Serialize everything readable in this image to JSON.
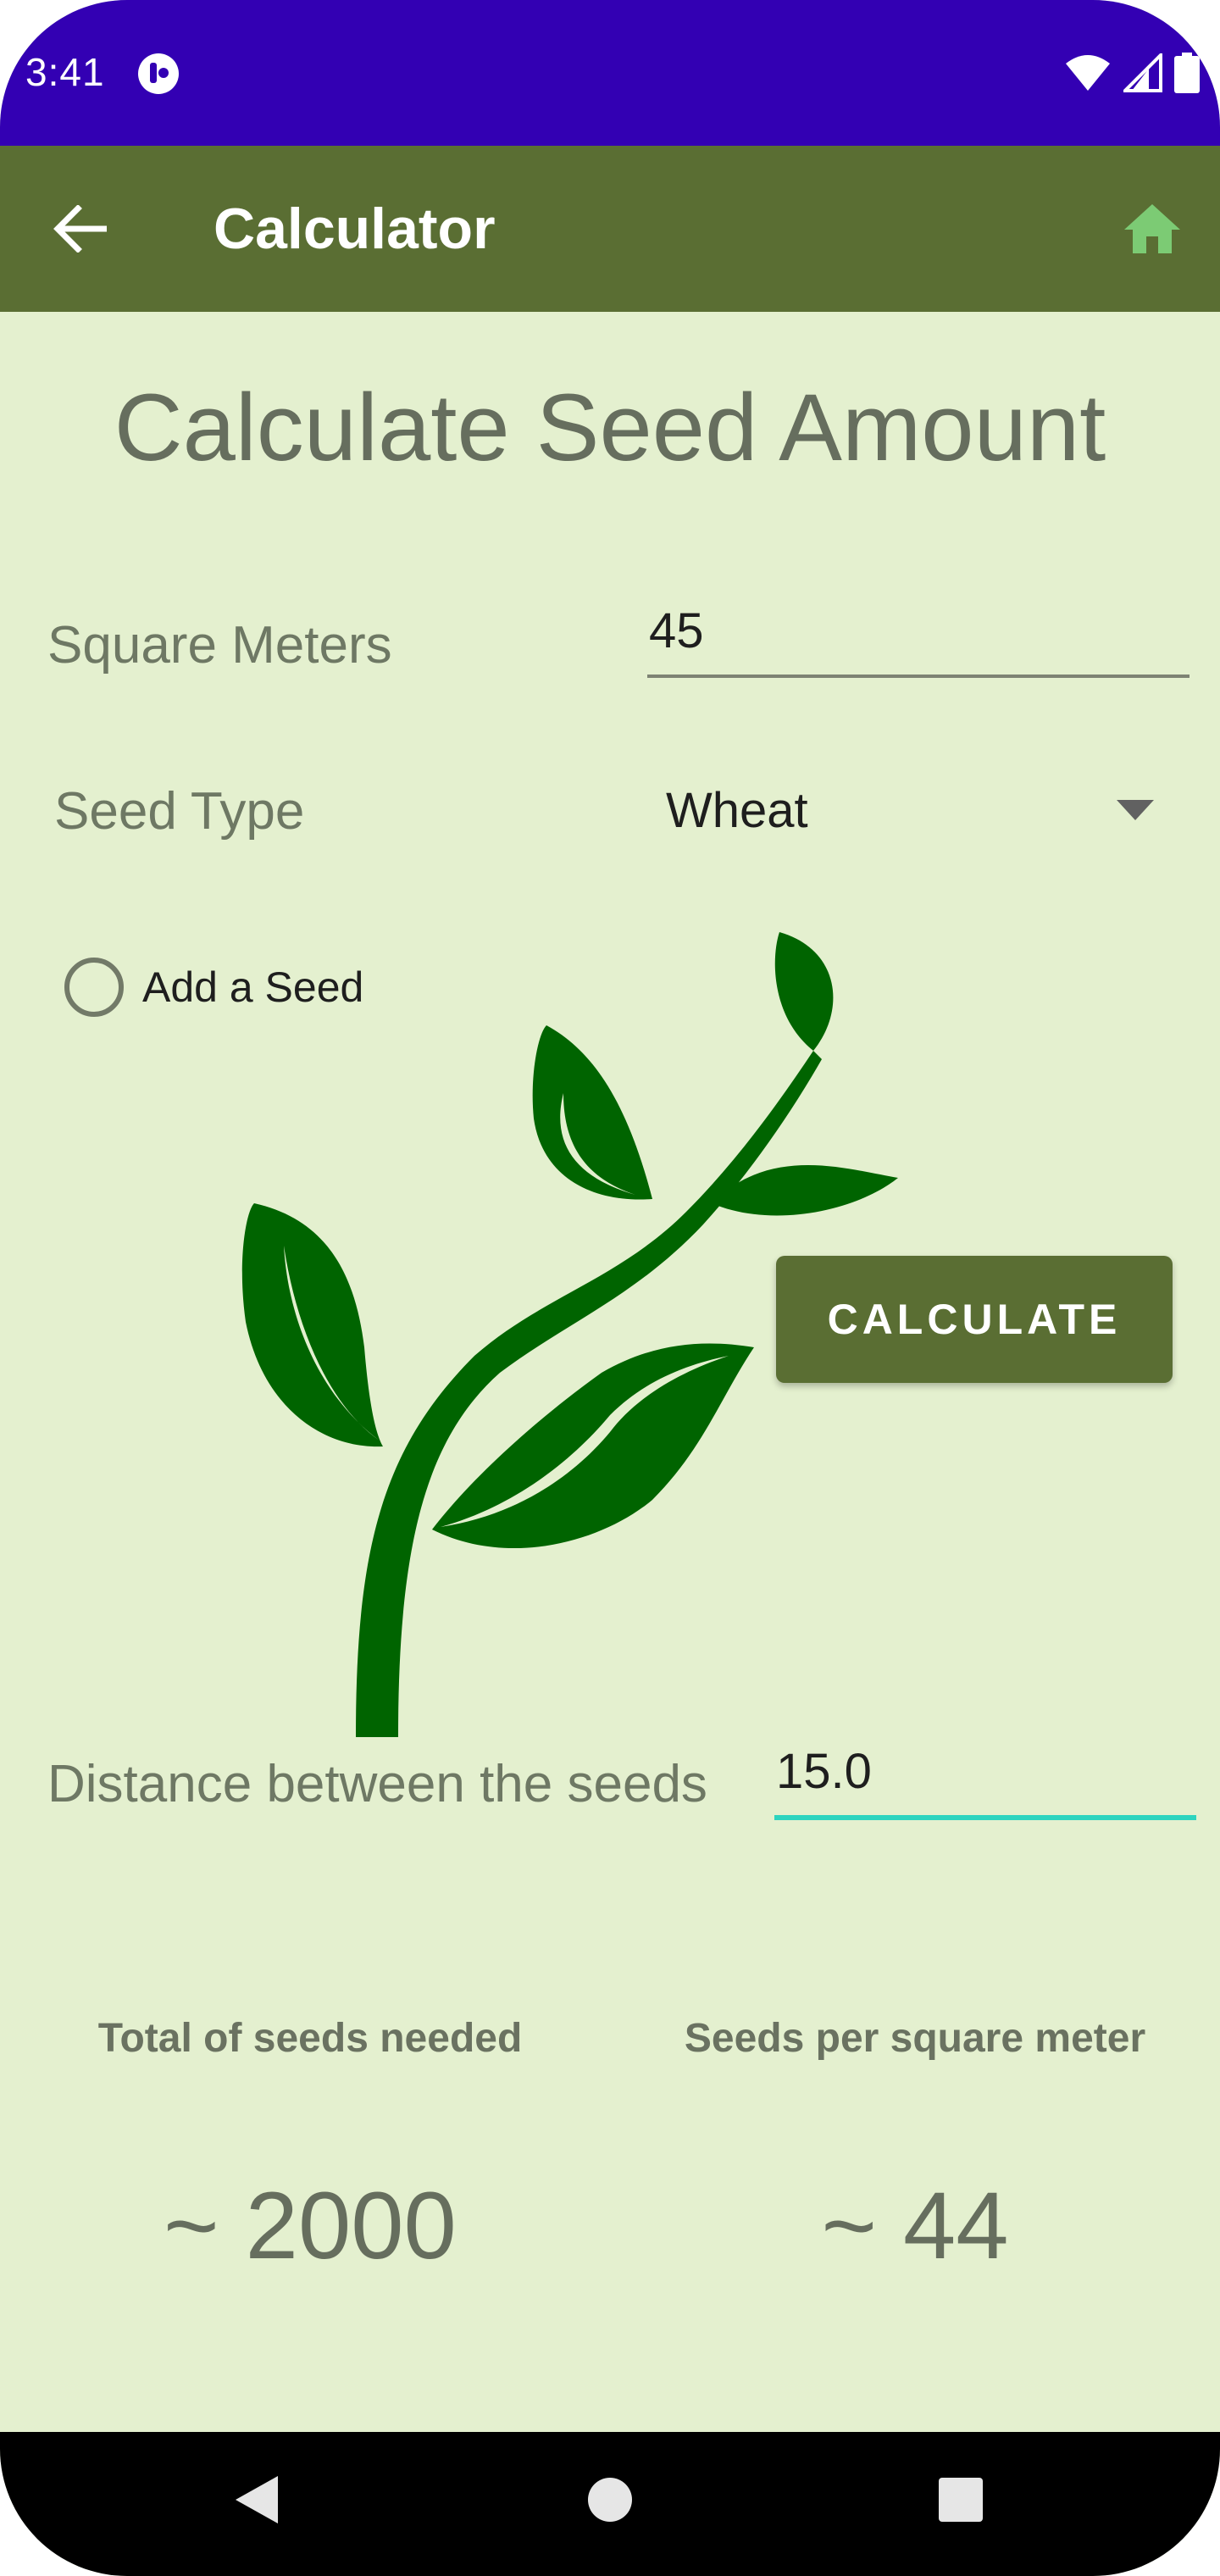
{
  "status_bar": {
    "time": "3:41",
    "app_icon": "notification-app-icon",
    "icons": [
      "wifi-icon",
      "signal-icon",
      "battery-icon"
    ]
  },
  "app_bar": {
    "title": "Calculator",
    "back_icon": "arrow-back-icon",
    "home_icon": "home-icon",
    "home_icon_color": "#7ccb74",
    "background_color": "#5a6e33"
  },
  "main": {
    "page_title": "Calculate Seed Amount",
    "square_meters": {
      "label": "Square Meters",
      "value": "45"
    },
    "seed_type": {
      "label": "Seed Type",
      "selected": "Wheat"
    },
    "add_seed": {
      "label": "Add a Seed",
      "checked": false
    },
    "calculate_button": {
      "label": "CALCULATE"
    },
    "distance": {
      "label": "Distance between the seeds",
      "value": "15.0"
    },
    "results": {
      "total_label": "Total of seeds needed",
      "total_value": "~ 2000",
      "per_sqm_label": "Seeds per square meter",
      "per_sqm_value": "~ 44"
    }
  },
  "nav_bar": {
    "icons": [
      "back-triangle-icon",
      "home-circle-icon",
      "recents-square-icon"
    ]
  },
  "colors": {
    "status_bar": "#3300b3",
    "background": "#e4f0cf",
    "accent_underline": "#2dd4bf",
    "plant": "#006400"
  }
}
